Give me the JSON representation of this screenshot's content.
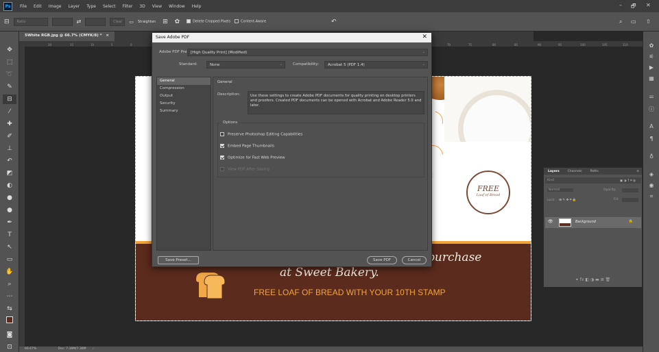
{
  "menubar": {
    "app_icon": "Ps",
    "items": [
      "File",
      "Edit",
      "Image",
      "Layer",
      "Type",
      "Select",
      "Filter",
      "3D",
      "View",
      "Window",
      "Help"
    ],
    "window_controls": [
      "–",
      "🗗",
      "✕"
    ]
  },
  "options_bar": {
    "ratio_placeholder": "Ratio",
    "clear_label": "Clear",
    "straighten_label": "Straighten",
    "delete_cropped_label": "Delete Cropped Pixels",
    "content_aware_label": "Content-Aware"
  },
  "document": {
    "tab_title": "5White RGB.jpg @ 66.7% (CMYK/8) *",
    "tab_close": "×",
    "ruler_ticks_top": [
      "20",
      "15",
      "10",
      "5",
      "0",
      "70",
      "75",
      "80",
      "85",
      "90",
      "95",
      "100",
      "105",
      "110"
    ],
    "zoom": "66.67%",
    "doc_info": "Doc: 7.38M/7.38M"
  },
  "canvas": {
    "purchase_text": "purchase",
    "bakery_text": "at Sweet Bakery.",
    "free_loaf_text": "FREE LOAF OF BREAD WITH YOUR 10TH STAMP",
    "seal_free": "FREE",
    "seal_sub": "Loaf of Bread"
  },
  "dialog": {
    "title": "Save Adobe PDF",
    "close": "✕",
    "preset_label": "Adobe PDF Preset:",
    "preset_value": "[High Quality Print] (Modified)",
    "standard_label": "Standard:",
    "standard_value": "None",
    "compat_label": "Compatibility:",
    "compat_value": "Acrobat 5 (PDF 1.4)",
    "sidebar": [
      "General",
      "Compression",
      "Output",
      "Security",
      "Summary"
    ],
    "active_section": "General",
    "section_title": "General",
    "description_label": "Description:",
    "description_text": "Use these settings to create Adobe PDF documents for quality printing on desktop printers and proofers.  Created PDF documents can be opened with Acrobat and Adobe Reader 5.0 and later.",
    "options_title": "Options",
    "options": [
      {
        "label": "Preserve Photoshop Editing Capabilities",
        "checked": false
      },
      {
        "label": "Embed Page Thumbnails",
        "checked": true
      },
      {
        "label": "Optimize for Fast Web Preview",
        "checked": true
      },
      {
        "label": "View PDF After Saving",
        "checked": false,
        "disabled": true
      }
    ],
    "save_preset_label": "Save Preset...",
    "save_pdf_label": "Save PDF",
    "cancel_label": "Cancel"
  },
  "layers_panel": {
    "tabs": [
      "Layers",
      "Channels",
      "Paths"
    ],
    "kind_placeholder": "Kind",
    "blend_mode": "Normal",
    "opacity_label": "Opacity:",
    "lock_label": "Lock:",
    "fill_label": "Fill:",
    "layer_name": "Background",
    "bottom_icons": "⚭  fx  ◧  ◑  ▬  ⊞  🗑"
  }
}
